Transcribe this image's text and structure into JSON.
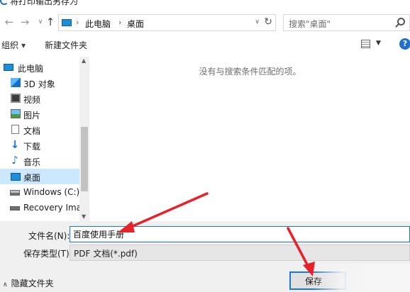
{
  "window": {
    "title": "将打印输出另存为"
  },
  "address_bar": {
    "back_icon": "arrow-left-icon",
    "forward_icon": "arrow-right-icon",
    "recent_icon": "chevron-down-icon",
    "up_icon": "arrow-up-icon",
    "breadcrumbs": [
      "此电脑",
      "桌面"
    ],
    "separator": "›",
    "dropdown": "∨",
    "refresh": "↻"
  },
  "search": {
    "placeholder": "搜索\"桌面\""
  },
  "toolbar": {
    "organize_label": "组织",
    "new_folder_label": "新建文件夹",
    "caret": "▼",
    "help": "?"
  },
  "sidebar": {
    "items": [
      {
        "label": "此电脑",
        "icon": "computer-icon"
      },
      {
        "label": "3D 对象",
        "icon": "3d-objects-icon"
      },
      {
        "label": "视频",
        "icon": "video-icon"
      },
      {
        "label": "图片",
        "icon": "pictures-icon"
      },
      {
        "label": "文档",
        "icon": "documents-icon"
      },
      {
        "label": "下载",
        "icon": "download-icon"
      },
      {
        "label": "音乐",
        "icon": "music-icon"
      },
      {
        "label": "桌面",
        "icon": "desktop-icon",
        "selected": true
      },
      {
        "label": "Windows (C:)",
        "icon": "drive-icon"
      },
      {
        "label": "Recovery Imag",
        "icon": "drive-icon"
      }
    ]
  },
  "main": {
    "empty_message": "没有与搜索条件匹配的项。"
  },
  "form": {
    "filename_label": "文件名(N):",
    "filename_value": "百度使用手册",
    "filetype_label": "保存类型(T):",
    "filetype_value": "PDF 文档(*.pdf)",
    "hide_folders_label": "隐藏文件夹",
    "save_label": "保存"
  },
  "colors": {
    "accent": "#1c78d4",
    "arrow": "#e8202a",
    "selection": "#cce8ff"
  }
}
